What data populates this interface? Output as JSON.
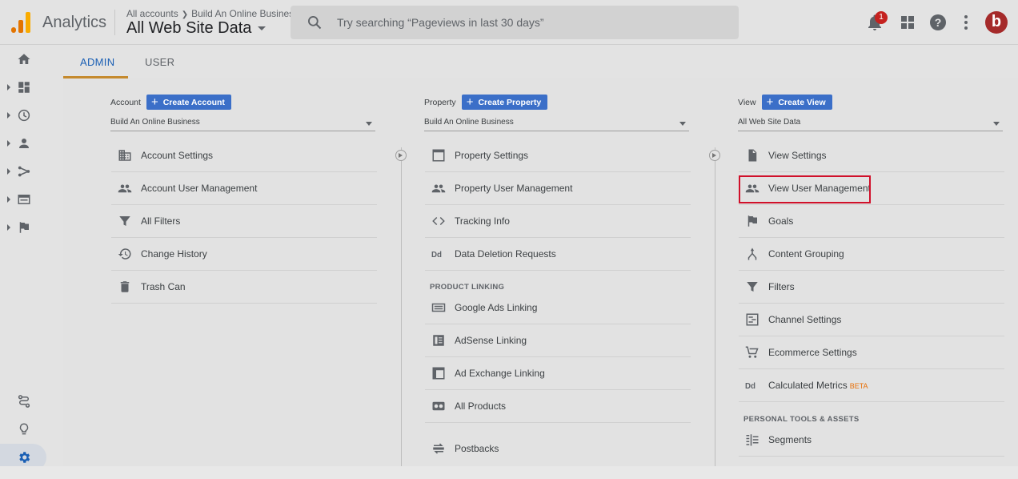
{
  "header": {
    "app_title": "Analytics",
    "breadcrumb_root": "All accounts",
    "breadcrumb_account": "Build An Online Business",
    "view_name": "All Web Site Data",
    "search_placeholder": "Try searching “Pageviews in last 30 days”",
    "notification_count": "1",
    "avatar_letter": "b",
    "brand_color": "#f9ab00",
    "avatar_color": "#a52a2a"
  },
  "sidebar": {
    "items": [
      {
        "icon": "home-icon"
      },
      {
        "icon": "customization-icon"
      },
      {
        "icon": "realtime-icon"
      },
      {
        "icon": "audience-icon"
      },
      {
        "icon": "acquisition-icon"
      },
      {
        "icon": "behavior-icon"
      },
      {
        "icon": "conversions-icon"
      }
    ],
    "bottom": [
      {
        "icon": "attribution-icon"
      },
      {
        "icon": "discover-icon"
      },
      {
        "icon": "admin-gear-icon"
      }
    ]
  },
  "tabs": {
    "admin": "ADMIN",
    "user": "USER"
  },
  "account": {
    "label": "Account",
    "create_label": "Create Account",
    "selected": "Build An Online Business",
    "items": [
      "Account Settings",
      "Account User Management",
      "All Filters",
      "Change History",
      "Trash Can"
    ]
  },
  "property": {
    "label": "Property",
    "create_label": "Create Property",
    "selected": "Build An Online Business",
    "items": [
      "Property Settings",
      "Property User Management",
      "Tracking Info",
      "Data Deletion Requests"
    ],
    "section_label": "PRODUCT LINKING",
    "linking_items": [
      "Google Ads Linking",
      "AdSense Linking",
      "Ad Exchange Linking",
      "All Products",
      "Postbacks"
    ]
  },
  "view": {
    "label": "View",
    "create_label": "Create View",
    "selected": "All Web Site Data",
    "items": [
      "View Settings",
      "View User Management",
      "Goals",
      "Content Grouping",
      "Filters",
      "Channel Settings",
      "Ecommerce Settings",
      "Calculated Metrics"
    ],
    "beta_label": "BETA",
    "section_label": "PERSONAL TOOLS & ASSETS",
    "tools_items": [
      "Segments"
    ]
  },
  "colors": {
    "accent_blue": "#3b6fc8",
    "highlight_red": "#d0102a",
    "tab_underline": "#c58a2e"
  }
}
